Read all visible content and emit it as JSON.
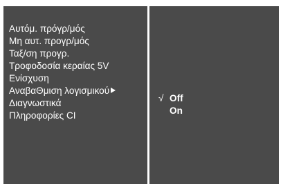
{
  "menu": {
    "items": [
      {
        "label": "Αυτόμ. πρόγρ/μός"
      },
      {
        "label": "Μη αυτ. προγρ/μός"
      },
      {
        "label": "Ταξ/ση προγρ."
      },
      {
        "label": "Τροφοδοσία κεραίας 5V"
      },
      {
        "label": "Ενίσχυση"
      },
      {
        "label": "ΑναβαΘμιση λογισμικού",
        "selected": true
      },
      {
        "label": "Διαγνωστικά"
      },
      {
        "label": "Πληροφορίες CI"
      }
    ]
  },
  "submenu": {
    "check_glyph": "√",
    "options": [
      {
        "label": "Off",
        "checked": true
      },
      {
        "label": "On",
        "checked": false
      }
    ]
  },
  "colors": {
    "panel_background": "#4a4a4a",
    "border": "#ffffff",
    "text": "#ffffff"
  }
}
